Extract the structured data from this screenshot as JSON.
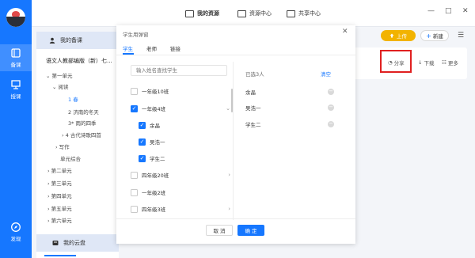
{
  "rail": {
    "items": [
      {
        "label": "备课",
        "icon": "book-icon"
      },
      {
        "label": "授课",
        "icon": "teach-icon"
      },
      {
        "label": "发现",
        "icon": "compass-icon"
      }
    ]
  },
  "topbar": {
    "tabs": [
      {
        "label": "我的资源",
        "active": true
      },
      {
        "label": "资源中心",
        "active": false
      },
      {
        "label": "共享中心",
        "active": false
      }
    ],
    "window_controls": [
      "—",
      "□",
      "✕"
    ]
  },
  "tree": {
    "header": "我的备课",
    "book_title": "语文人教部编版（新）七...",
    "rows": [
      "第一单元",
      "阅读",
      "1 春",
      "2 济南的冬天",
      "3* 雨的四季",
      "4 古代诗歌四首",
      "写作",
      "单元综合",
      "第二单元",
      "第三单元",
      "第四单元",
      "第五单元",
      "第六单元"
    ],
    "footer": "我的云盘"
  },
  "main": {
    "upload_label": "上传",
    "new_label": "新建",
    "share_label": "分享",
    "download_label": "下载",
    "more_label": "更多"
  },
  "modal": {
    "title": "学生用弹窗",
    "tabs": [
      "学生",
      "老师",
      "链接"
    ],
    "search_placeholder": "输入姓名查找学生",
    "list": [
      {
        "label": "一年级10班",
        "checked": false,
        "indent": false,
        "chevron": ""
      },
      {
        "label": "一年级4班",
        "checked": true,
        "indent": false,
        "chevron": "⌄"
      },
      {
        "label": "余晶",
        "checked": true,
        "indent": true,
        "chevron": ""
      },
      {
        "label": "吴浩一",
        "checked": true,
        "indent": true,
        "chevron": ""
      },
      {
        "label": "学生二",
        "checked": true,
        "indent": true,
        "chevron": ""
      },
      {
        "label": "四年级20班",
        "checked": false,
        "indent": false,
        "chevron": "›"
      },
      {
        "label": "一年级2班",
        "checked": false,
        "indent": false,
        "chevron": ""
      },
      {
        "label": "四年级3班",
        "checked": false,
        "indent": false,
        "chevron": "›"
      }
    ],
    "selected_header": "已选3人",
    "clear_label": "清空",
    "selected": [
      "余晶",
      "吴浩一",
      "学生二"
    ],
    "cancel_label": "取 消",
    "ok_label": "确 定"
  },
  "colors": {
    "primary": "#1677ff",
    "upload": "#f2b300",
    "highlight": "#e02020"
  }
}
